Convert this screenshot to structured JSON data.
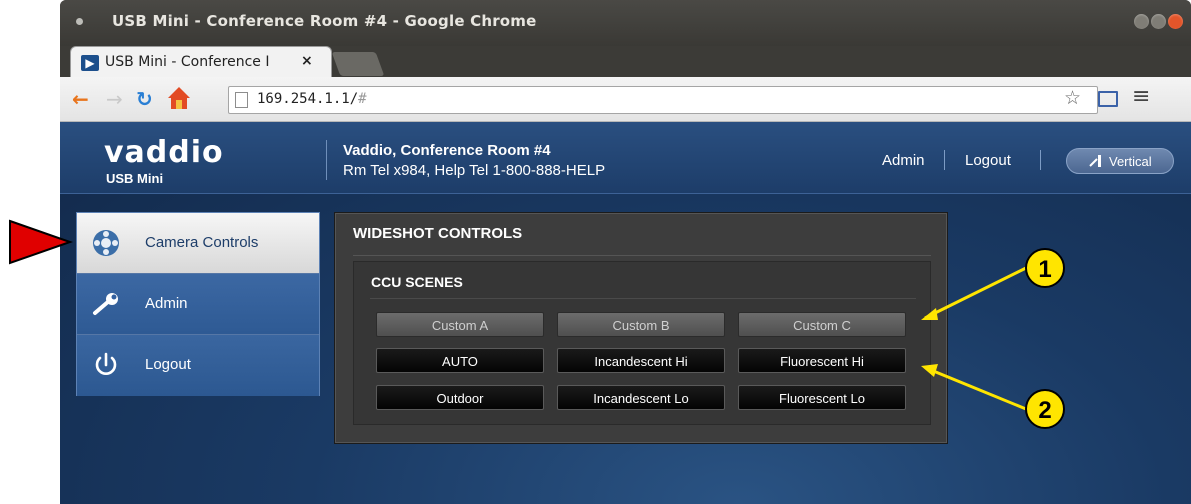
{
  "browser": {
    "window_title": "USB Mini - Conference Room #4 - Google Chrome",
    "tab_title": "USB Mini - Conference I",
    "tab_close": "×",
    "url_host": "169.254.1.1/",
    "url_hash": "#"
  },
  "header": {
    "logo": "vaddio",
    "product": "USB Mini",
    "title": "Vaddio, Conference Room #4",
    "subtitle": "Rm Tel x984, Help Tel 1-800-888-HELP",
    "admin_link": "Admin",
    "logout_link": "Logout",
    "vertical_button": "Vertical"
  },
  "sidebar": {
    "items": [
      {
        "label": "Camera Controls",
        "icon": "camera-controls-icon",
        "active": true
      },
      {
        "label": "Admin",
        "icon": "wrench-icon",
        "active": false
      },
      {
        "label": "Logout",
        "icon": "power-icon",
        "active": false
      }
    ]
  },
  "panel": {
    "title": "WIDESHOT CONTROLS",
    "section_title": "CCU SCENES",
    "custom_buttons": [
      "Custom A",
      "Custom B",
      "Custom C"
    ],
    "preset_buttons": [
      "AUTO",
      "Incandescent Hi",
      "Fluorescent Hi",
      "Outdoor",
      "Incandescent Lo",
      "Fluorescent Lo"
    ]
  },
  "annotations": {
    "callout_1": "1",
    "callout_2": "2",
    "callout_color": "#ffe500",
    "pointer_color": "#e00000"
  }
}
